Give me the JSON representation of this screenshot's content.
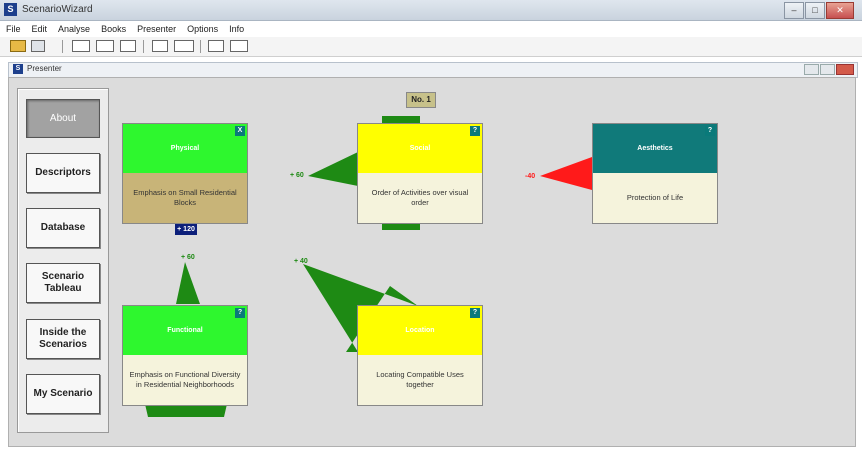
{
  "app": {
    "title": "ScenarioWizard",
    "icon": "app-s-icon"
  },
  "window_controls": {
    "minimize": "–",
    "maximize": "□",
    "close": "✕"
  },
  "menu": [
    "File",
    "Edit",
    "Analyse",
    "Books",
    "Presenter",
    "Options",
    "Info"
  ],
  "presenter": {
    "title": "Presenter"
  },
  "sidebar": {
    "about": "About",
    "descriptors": "Descriptors",
    "database": "Database",
    "scenario_tableau": "Scenario Tableau",
    "inside_scenarios": "Inside the Scenarios",
    "my_scenario": "My Scenario"
  },
  "tags": {
    "no1": "No. 1",
    "plus120": "+ 120"
  },
  "cards": {
    "physical": {
      "title": "Physical",
      "body": "Emphasis on Small Residential Blocks",
      "badge": "X"
    },
    "social": {
      "title": "Social",
      "body": "Order of Activities over visual order",
      "badge": "?"
    },
    "aesthetics": {
      "title": "Aesthetics",
      "body": "Protection of Life",
      "badge": "?"
    },
    "functional": {
      "title": "Functional",
      "body": "Emphasis on Functional Diversity in Residential Neighborhoods",
      "badge": "?"
    },
    "location": {
      "title": "Location",
      "body": "Locating Compatible Uses together",
      "badge": "?"
    }
  },
  "arrows": {
    "social_physical": "+ 60",
    "aesthetics": "-40",
    "functional": "+ 60",
    "location": "+ 40"
  },
  "colors": {
    "green": "#1e8a14",
    "red": "#ff1a1a",
    "bright_green": "#2ef72e",
    "yellow": "#ffff00",
    "teal": "#107a7a",
    "khaki": "#c8b478",
    "cream": "#f5f3dc"
  }
}
